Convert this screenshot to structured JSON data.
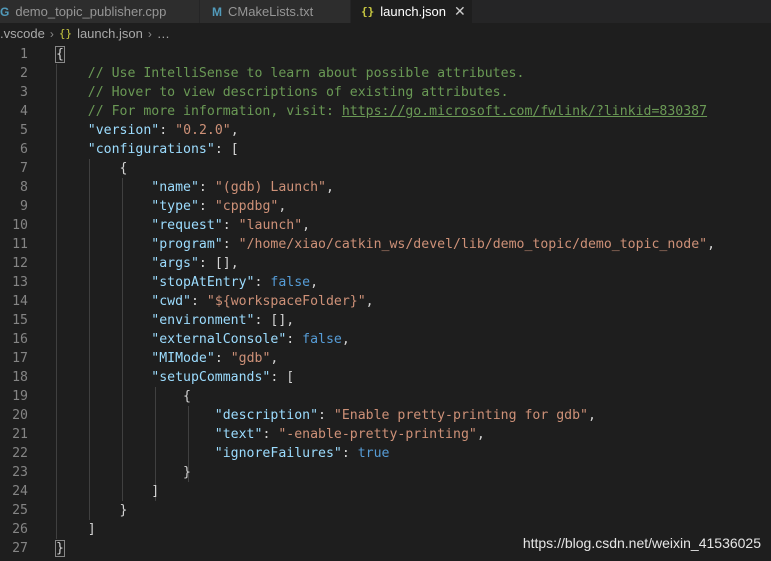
{
  "tabs": [
    {
      "icon": "G",
      "label": "demo_topic_publisher.cpp",
      "active": false
    },
    {
      "icon": "M",
      "label": "CMakeLists.txt",
      "active": false
    },
    {
      "icon": "{}",
      "label": "launch.json",
      "active": true
    }
  ],
  "tab_close_glyph": "✕",
  "breadcrumb": {
    "folder": ".vscode",
    "file_icon": "{}",
    "file": "launch.json",
    "more": "…"
  },
  "line_numbers": [
    "1",
    "2",
    "3",
    "4",
    "5",
    "6",
    "7",
    "8",
    "9",
    "10",
    "11",
    "12",
    "13",
    "14",
    "15",
    "16",
    "17",
    "18",
    "19",
    "20",
    "21",
    "22",
    "23",
    "24",
    "25",
    "26",
    "27"
  ],
  "code": {
    "l1_brace": "{",
    "l2_comment": "// Use IntelliSense to learn about possible attributes.",
    "l3_comment": "// Hover to view descriptions of existing attributes.",
    "l4_comment": "// For more information, visit: ",
    "l4_url": "https://go.microsoft.com/fwlink/?linkid=830387",
    "version_key": "\"version\"",
    "version_val": "\"0.2.0\"",
    "configurations_key": "\"configurations\"",
    "open_bracket": "[",
    "open_brace": "{",
    "name_key": "\"name\"",
    "name_val": "\"(gdb) Launch\"",
    "type_key": "\"type\"",
    "type_val": "\"cppdbg\"",
    "request_key": "\"request\"",
    "request_val": "\"launch\"",
    "program_key": "\"program\"",
    "program_val": "\"/home/xiao/catkin_ws/devel/lib/demo_topic/demo_topic_node\"",
    "args_key": "\"args\"",
    "args_val": "[]",
    "stopAtEntry_key": "\"stopAtEntry\"",
    "stopAtEntry_val": "false",
    "cwd_key": "\"cwd\"",
    "cwd_val": "\"${workspaceFolder}\"",
    "environment_key": "\"environment\"",
    "environment_val": "[]",
    "externalConsole_key": "\"externalConsole\"",
    "externalConsole_val": "false",
    "MIMode_key": "\"MIMode\"",
    "MIMode_val": "\"gdb\"",
    "setupCommands_key": "\"setupCommands\"",
    "description_key": "\"description\"",
    "description_val": "\"Enable pretty-printing for gdb\"",
    "text_key": "\"text\"",
    "text_val": "\"-enable-pretty-printing\"",
    "ignoreFailures_key": "\"ignoreFailures\"",
    "ignoreFailures_val": "true",
    "close_brace": "}",
    "close_bracket": "]",
    "l27_brace": "}"
  },
  "watermark": "https://blog.csdn.net/weixin_41536025",
  "colors": {
    "editor_bg": "#1e1e1e",
    "tab_inactive_bg": "#2d2d2d",
    "key": "#9cdcfe",
    "string": "#ce9178",
    "comment": "#6a9955",
    "boolean": "#569cd6",
    "line_number": "#858585"
  }
}
